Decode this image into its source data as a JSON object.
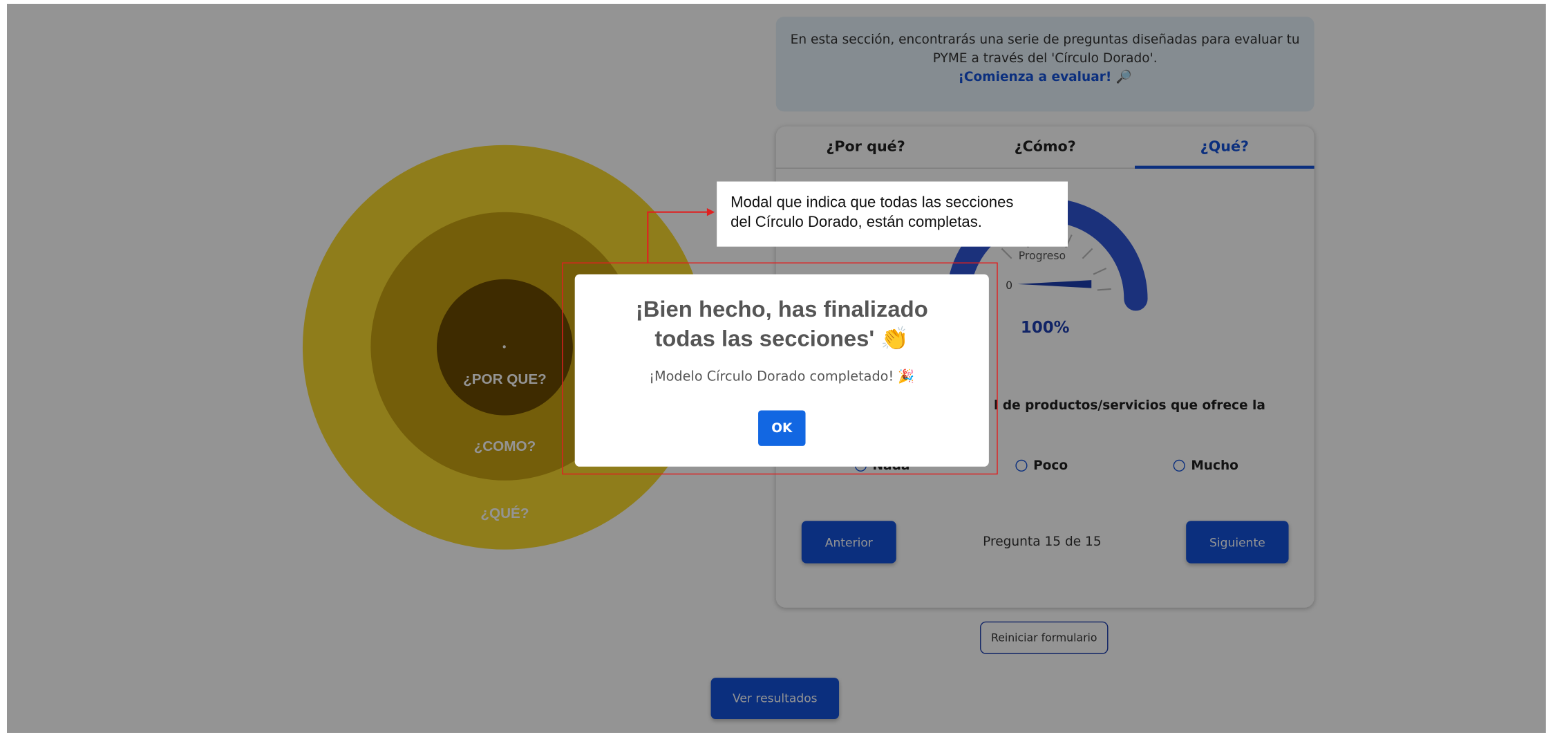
{
  "intro": {
    "line1": "En esta sección, encontrarás una serie de preguntas diseñadas para evaluar tu",
    "line2": "PYME a través del 'Círculo Dorado'.",
    "cta": "¡Comienza a evaluar! 🔎"
  },
  "circle": {
    "outer_label": "¿QUÉ?",
    "middle_label": "¿COMO?",
    "inner_label": "¿POR QUE?",
    "colors": {
      "outer": "#f7d82f",
      "middle": "#c8a312",
      "inner": "#6b4a00"
    }
  },
  "tabs": [
    {
      "label": "¿Por qué?"
    },
    {
      "label": "¿Cómo?"
    },
    {
      "label": "¿Qué?"
    }
  ],
  "active_tab": "¿Qué?",
  "gauge": {
    "label": "Progreso",
    "min_label": "0",
    "value_text": "100%",
    "value": 1.0
  },
  "question": {
    "text": "l de productos/servicios que ofrece la",
    "options": [
      {
        "label": "Nada"
      },
      {
        "label": "Poco"
      },
      {
        "label": "Mucho"
      }
    ]
  },
  "nav": {
    "prev": "Anterior",
    "next": "Siguiente",
    "counter": "Pregunta 15 de 15"
  },
  "reset_label": "Reiniciar formulario",
  "results_label": "Ver resultados",
  "modal": {
    "title_line1": "¡Bien hecho, has finalizado",
    "title_line2": "todas las secciones' 👏",
    "text": "¡Modelo Círculo Dorado completado! 🎉",
    "ok": "OK"
  },
  "annotation": {
    "line1": "Modal que indica que todas las secciones",
    "line2": "del Círculo Dorado, están completas."
  },
  "colors": {
    "primary": "#1452d9",
    "annotation": "#e02020"
  }
}
